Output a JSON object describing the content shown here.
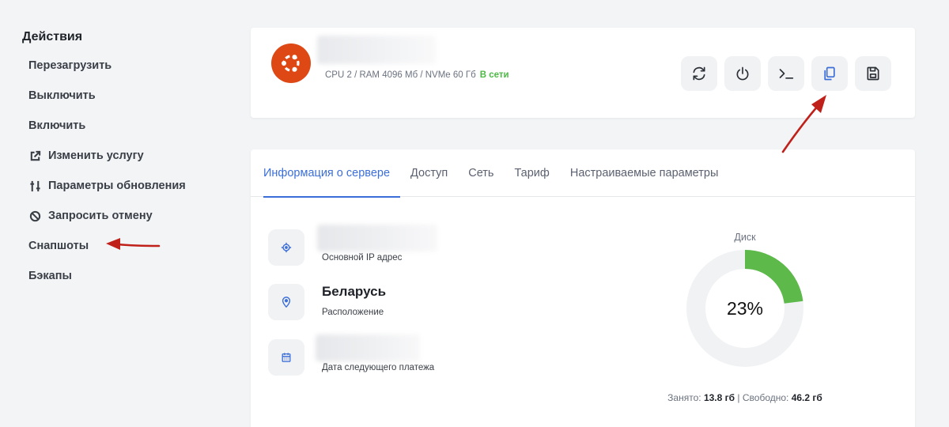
{
  "sidebar": {
    "title": "Действия",
    "items": [
      {
        "label": "Перезагрузить",
        "icon": ""
      },
      {
        "label": "Выключить",
        "icon": ""
      },
      {
        "label": "Включить",
        "icon": ""
      },
      {
        "label": "Изменить услугу",
        "icon": "external-link-icon"
      },
      {
        "label": "Параметры обновления",
        "icon": "sliders-icon"
      },
      {
        "label": "Запросить отмену",
        "icon": "ban-icon"
      },
      {
        "label": "Снапшоты",
        "icon": ""
      },
      {
        "label": "Бэкапы",
        "icon": ""
      }
    ]
  },
  "server": {
    "os_icon": "ubuntu-logo",
    "specs": "CPU 2 / RAM 4096 Мб / NVMe 60 Гб",
    "status": "В сети",
    "actions": [
      {
        "icon": "refresh-icon"
      },
      {
        "icon": "power-icon"
      },
      {
        "icon": "terminal-icon"
      },
      {
        "icon": "copy-icon"
      },
      {
        "icon": "save-icon"
      }
    ]
  },
  "tabs": [
    {
      "label": "Информация о сервере",
      "active": true
    },
    {
      "label": "Доступ",
      "active": false
    },
    {
      "label": "Сеть",
      "active": false
    },
    {
      "label": "Тариф",
      "active": false
    },
    {
      "label": "Настраиваемые параметры",
      "active": false
    }
  ],
  "info": {
    "ip_label": "Основной IP адрес",
    "location_value": "Беларусь",
    "location_label": "Расположение",
    "payment_label": "Дата следующего платежа"
  },
  "disk": {
    "title": "Диск",
    "percent_used": 23,
    "percent_text": "23%",
    "used_label": "Занято:",
    "used_value": "13.8 гб",
    "separator": "|",
    "free_label": "Свободно:",
    "free_value": "46.2 гб"
  },
  "colors": {
    "accent": "#3b6ed8",
    "online": "#4cb944",
    "disk_used": "#5cb94a",
    "disk_track": "#f1f2f4",
    "ubuntu": "#dd4814",
    "annotation_arrow": "#c0201a"
  }
}
